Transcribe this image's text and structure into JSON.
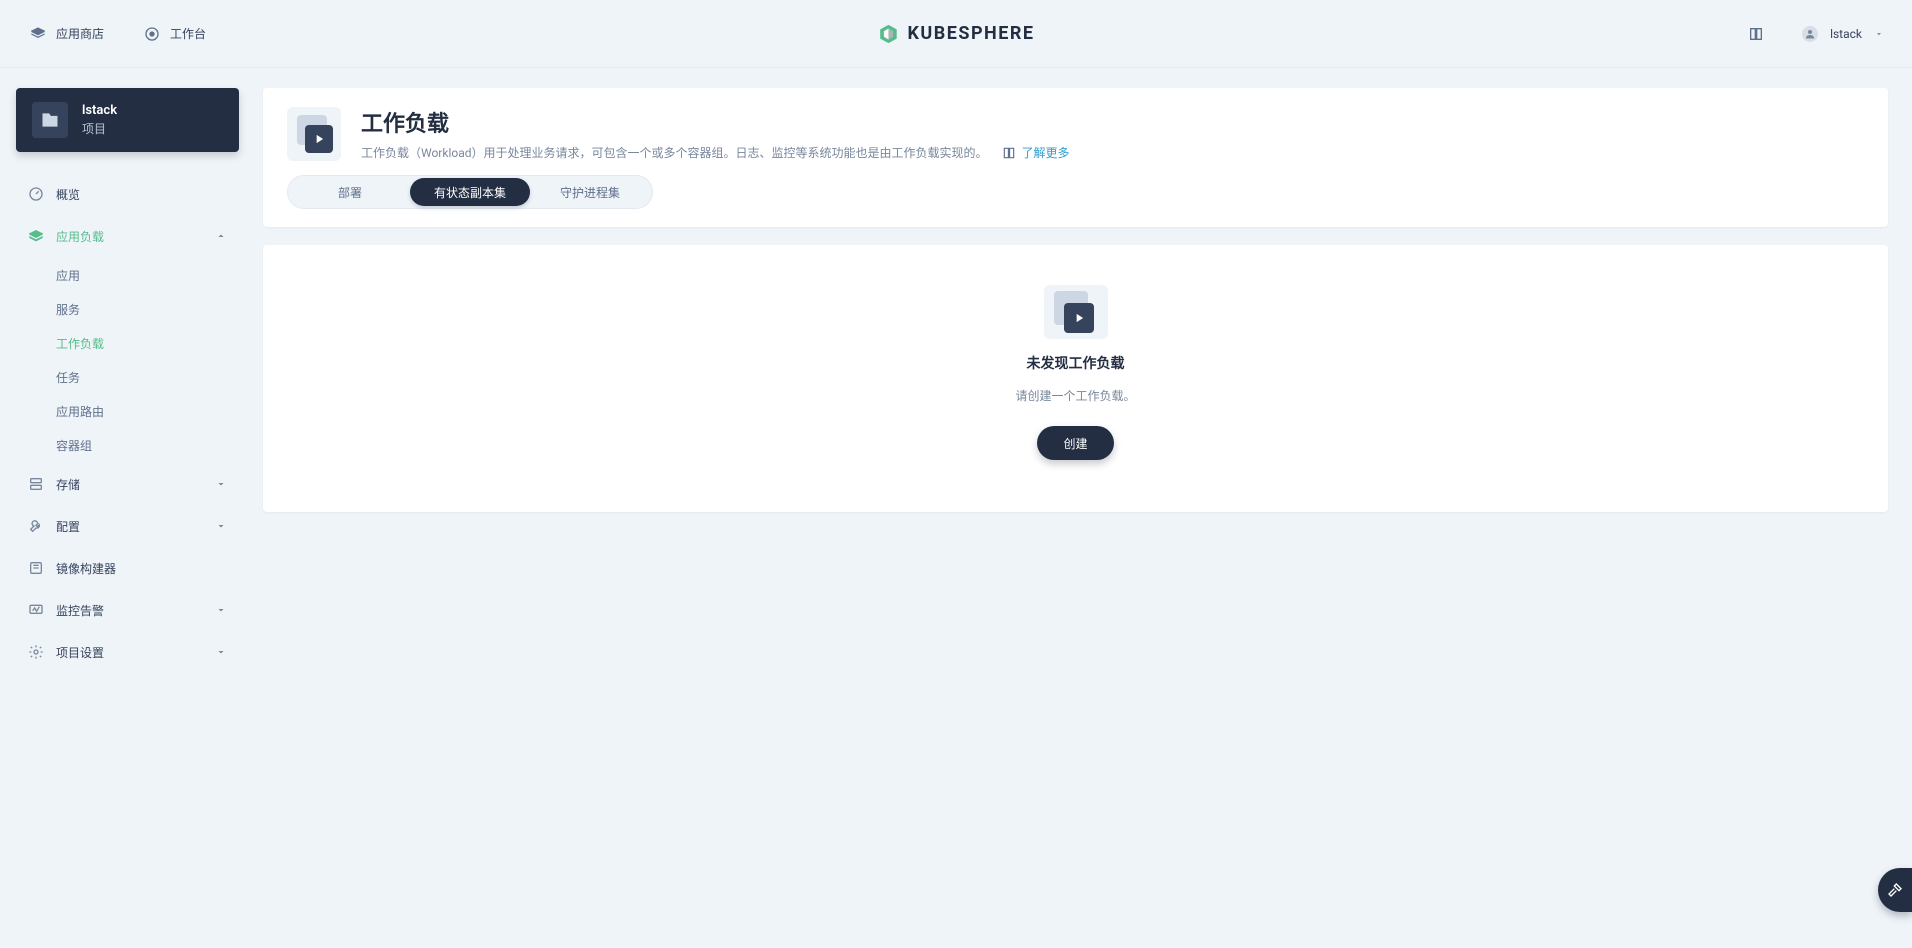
{
  "header": {
    "app_store": "应用商店",
    "workbench": "工作台",
    "brand": "KUBESPHERE",
    "user": "lstack"
  },
  "project": {
    "name": "lstack",
    "subtitle": "项目"
  },
  "nav": {
    "overview": "概览",
    "app_workloads": "应用负载",
    "app_workloads_children": {
      "apps": "应用",
      "services": "服务",
      "workloads": "工作负载",
      "jobs": "任务",
      "routes": "应用路由",
      "pods": "容器组"
    },
    "storage": "存储",
    "config": "配置",
    "image_builder": "镜像构建器",
    "monitor_alert": "监控告警",
    "project_settings": "项目设置"
  },
  "page": {
    "title": "工作负载",
    "description": "工作负载（Workload）用于处理业务请求，可包含一个或多个容器组。日志、监控等系统功能也是由工作负载实现的。",
    "learn_more": "了解更多"
  },
  "tabs": {
    "deployments": "部署",
    "statefulsets": "有状态副本集",
    "daemonsets": "守护进程集",
    "active": "statefulsets"
  },
  "empty": {
    "title": "未发现工作负载",
    "desc": "请创建一个工作负载。",
    "create": "创建"
  },
  "icons": {
    "fab": "toolbox-icon"
  }
}
